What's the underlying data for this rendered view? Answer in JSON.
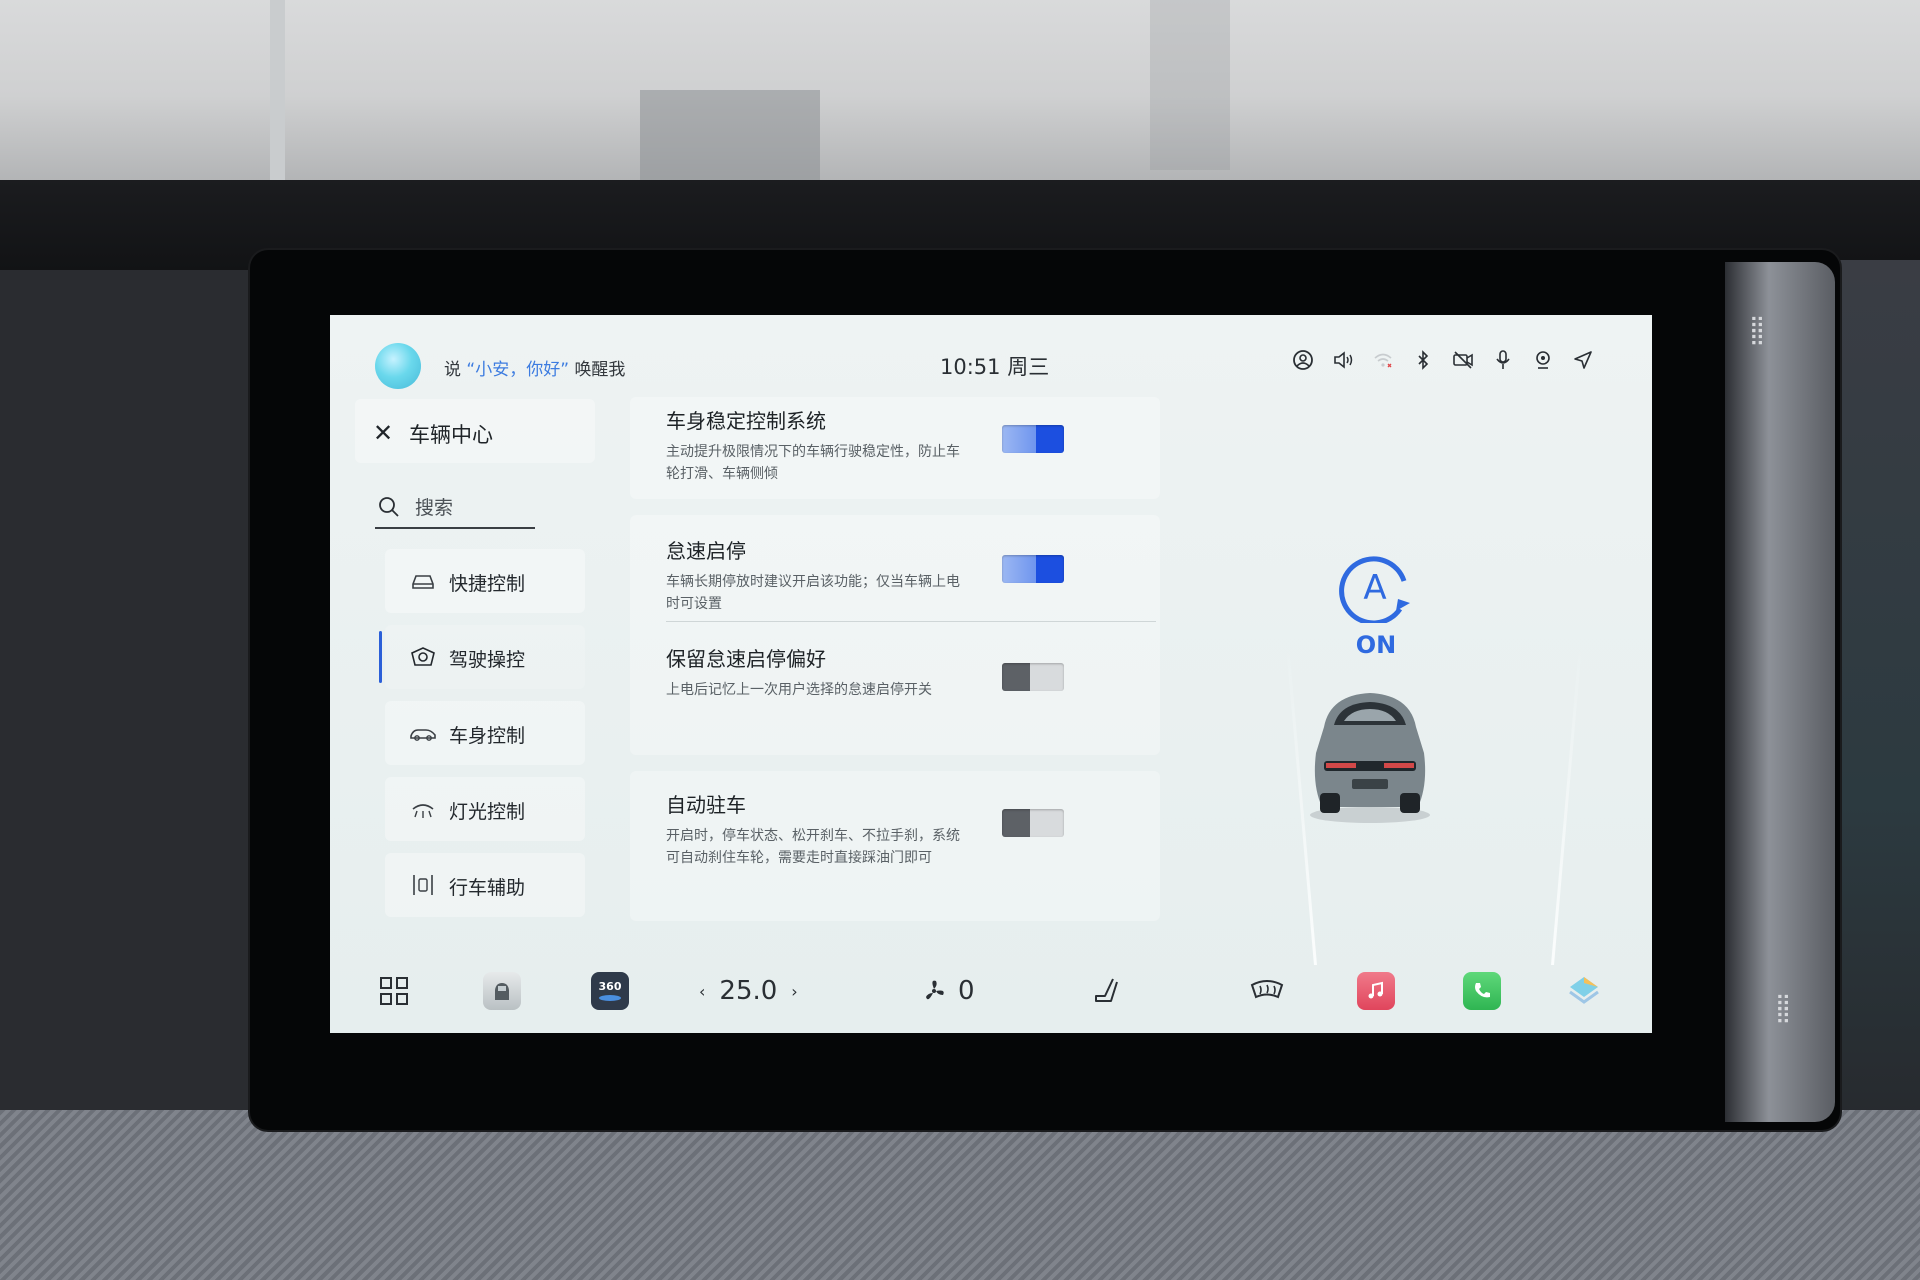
{
  "status_bar": {
    "wake_prefix": "说",
    "wake_phrase": "“小安，你好”",
    "wake_suffix": "唤醒我",
    "time": "10:51",
    "weekday": "周三",
    "icons": [
      "account-icon",
      "volume-icon",
      "wifi-icon",
      "bluetooth-icon",
      "camera-off-icon",
      "microphone-icon",
      "location-icon",
      "navigation-icon"
    ]
  },
  "sidebar": {
    "title": "车辆中心",
    "search_placeholder": "搜索",
    "items": [
      {
        "label": "快捷控制",
        "icon": "car-front-icon"
      },
      {
        "label": "驾驶操控",
        "icon": "steering-icon"
      },
      {
        "label": "车身控制",
        "icon": "car-side-icon"
      },
      {
        "label": "灯光控制",
        "icon": "headlight-icon"
      },
      {
        "label": "行车辅助",
        "icon": "lane-assist-icon"
      }
    ],
    "active_index": 1
  },
  "settings": [
    {
      "title": "车身稳定控制系统",
      "desc": "主动提升极限情况下的车辆行驶稳定性，防止车轮打滑、车辆侧倾",
      "enabled": true
    },
    {
      "title": "怠速启停",
      "desc": "车辆长期停放时建议开启该功能；仅当车辆上电时可设置",
      "enabled": true
    },
    {
      "title": "保留怠速启停偏好",
      "desc": "上电后记忆上一次用户选择的怠速启停开关",
      "enabled": false
    },
    {
      "title": "自动驻车",
      "desc": "开启时，停车状态、松开刹车、不拉手刹，系统可自动刹住车轮，需要走时直接踩油门即可",
      "enabled": false
    }
  ],
  "vehicle_visual": {
    "auto_hold_badge": "A",
    "auto_hold_state": "ON"
  },
  "dock": {
    "temperature": "25.0",
    "fan_level": "0",
    "camera_360_label": "360"
  },
  "colors": {
    "accent_blue": "#1c4fe0",
    "toggle_off": "#5d6166",
    "screen_bg": "#eef3f3"
  }
}
